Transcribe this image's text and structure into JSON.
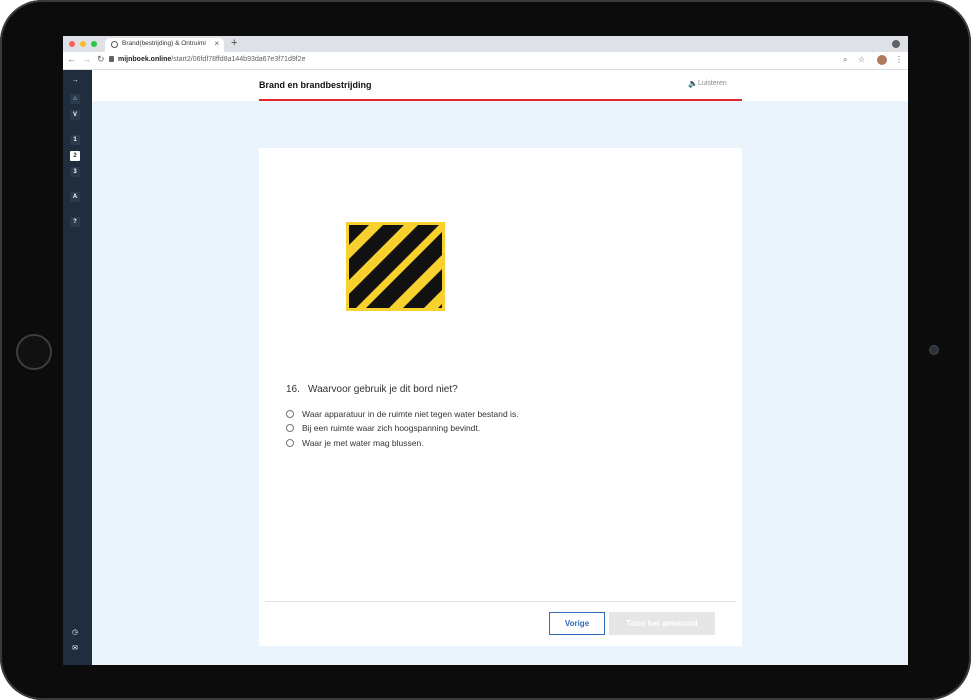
{
  "browser": {
    "tab_title": "Brand(bestrijding) & Ontruimi",
    "tab_close": "×",
    "new_tab": "+",
    "url_host": "mijnboek.online",
    "url_path": "/start2/06fdf78ffd8a144b93da67e3f71d9f2e"
  },
  "sidebar": {
    "toggle": "→",
    "home": "⌂",
    "v": "V",
    "chapters": [
      "1",
      "2",
      "3"
    ],
    "a": "A",
    "help": "?",
    "clock": "◷",
    "mail": "✉"
  },
  "header": {
    "title": "Brand en brandbestrijding",
    "listen": "Luisteren"
  },
  "question": {
    "number": "16.",
    "text": "Waarvoor gebruik je dit bord niet?",
    "options": [
      "Waar apparatuur in de ruimte niet tegen water bestand is.",
      "Bij een ruimte waar zich hoogspanning bevindt.",
      "Waar je met water mag blussen."
    ]
  },
  "buttons": {
    "previous": "Vorige",
    "show_answer": "Toon het antwoord"
  },
  "colors": {
    "accent_red": "#e1262d",
    "sidebar": "#1f2d3d",
    "primary_blue": "#2f6fb7",
    "sign_yellow": "#f7d12e"
  }
}
